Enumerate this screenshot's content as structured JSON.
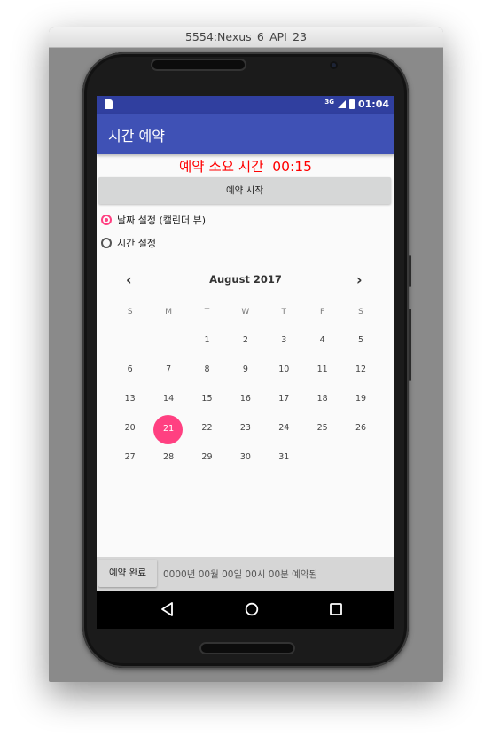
{
  "emulator": {
    "title": "5554:Nexus_6_API_23"
  },
  "status_bar": {
    "network": "3G",
    "time": "01:04",
    "icons": [
      "sd-card-icon",
      "signal-icon",
      "battery-icon"
    ]
  },
  "app_bar": {
    "title": "시간 예약"
  },
  "reservation": {
    "duration_label": "예약 소요 시간  00:15",
    "start_button": "예약 시작"
  },
  "mode": {
    "options": [
      {
        "label": "날짜 설정 (캘린더 뷰)",
        "checked": true
      },
      {
        "label": "시간 설정",
        "checked": false
      }
    ]
  },
  "calendar": {
    "month_label": "August 2017",
    "prev_icon": "chevron-left-icon",
    "next_icon": "chevron-right-icon",
    "weekdays": [
      "S",
      "M",
      "T",
      "W",
      "T",
      "F",
      "S"
    ],
    "weeks": [
      [
        "",
        "",
        "1",
        "2",
        "3",
        "4",
        "5"
      ],
      [
        "6",
        "7",
        "8",
        "9",
        "10",
        "11",
        "12"
      ],
      [
        "13",
        "14",
        "15",
        "16",
        "17",
        "18",
        "19"
      ],
      [
        "20",
        "21",
        "22",
        "23",
        "24",
        "25",
        "26"
      ],
      [
        "27",
        "28",
        "29",
        "30",
        "31",
        "",
        ""
      ]
    ],
    "selected_day": "21"
  },
  "footer": {
    "done_button": "예약 완료",
    "status_text": "0000년 00월 00일 00시 00분 예약됨"
  },
  "nav_bar": {
    "buttons": [
      "back-icon",
      "home-icon",
      "recents-icon"
    ]
  },
  "colors": {
    "primary": "#3f51b5",
    "primary_dark": "#303f9f",
    "accent": "#ff4081",
    "alert_text": "#ff0000"
  }
}
